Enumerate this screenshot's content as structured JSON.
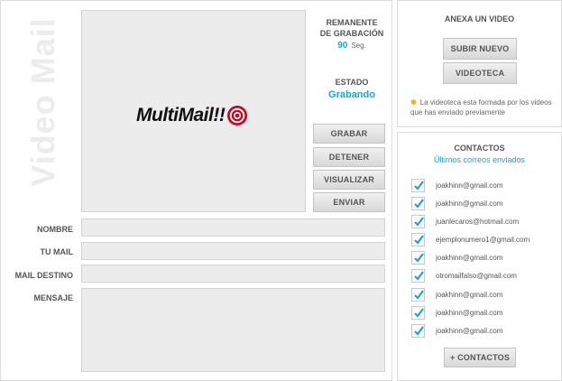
{
  "title": "Video Mail",
  "logo": {
    "text": "MultiMail!!",
    "icon": "target-icon"
  },
  "recording": {
    "remaining_label_line1": "REMANENTE",
    "remaining_label_line2": "DE GRABACIÓN",
    "remaining_value": "90",
    "remaining_unit": "Seg.",
    "state_label": "ESTADO",
    "state_value": "Grabando"
  },
  "controls": {
    "record": "GRABAR",
    "stop": "DETENER",
    "preview": "VISUALIZAR",
    "send": "ENVIAR"
  },
  "form": {
    "name_label": "NOMBRE",
    "mymail_label": "TU MAIL",
    "dest_label": "MAIL DESTINO",
    "message_label": "MENSAJE"
  },
  "attach": {
    "title": "ANEXA UN VIDEO",
    "upload": "SUBIR NUEVO",
    "library": "VIDEOTECA",
    "note": "La videoteca esta formada por los videos que has enviado previamente"
  },
  "contacts": {
    "title": "CONTACTOS",
    "subtitle": "Últimos correos enviados",
    "items": [
      {
        "email": "joakhinn@gmail.com",
        "checked": true
      },
      {
        "email": "joakhinn@gmail.com",
        "checked": true
      },
      {
        "email": "juanlecaros@hotmail.com",
        "checked": true
      },
      {
        "email": "ejemplonumero1@gmail.com",
        "checked": true
      },
      {
        "email": "joakhinn@gmail.com",
        "checked": true
      },
      {
        "email": "otromailfalso@gmail.com",
        "checked": true
      },
      {
        "email": "joakhinn@gmail.com",
        "checked": true
      },
      {
        "email": "joakhinn@gmail.com",
        "checked": true
      },
      {
        "email": "joakhinn@gmail.com",
        "checked": true
      }
    ],
    "add_button": "+ CONTACTOS"
  },
  "colors": {
    "accent": "#1aa3d4",
    "star": "#f5a623",
    "logo_red": "#d0021b"
  }
}
